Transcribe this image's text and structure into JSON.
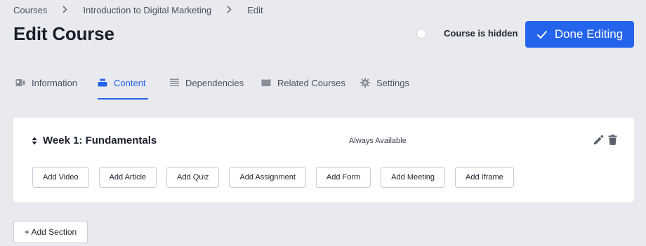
{
  "breadcrumb": {
    "items": [
      "Courses",
      "Introduction to Digital Marketing",
      "Edit"
    ],
    "separator": ">"
  },
  "header": {
    "title": "Edit Course",
    "visibility_label": "Course is hidden",
    "done_label": "Done Editing"
  },
  "tabs": [
    {
      "label": "Information",
      "icon": "id-card-icon"
    },
    {
      "label": "Content",
      "icon": "layers-icon",
      "active": true
    },
    {
      "label": "Dependencies",
      "icon": "list-icon"
    },
    {
      "label": "Related Courses",
      "icon": "book-icon"
    },
    {
      "label": "Settings",
      "icon": "gear-icon"
    }
  ],
  "section": {
    "title": "Week 1: Fundamentals",
    "availability": "Always Available",
    "add_buttons": [
      "Add Video",
      "Add Article",
      "Add Quiz",
      "Add Assignment",
      "Add Form",
      "Add Meeting",
      "Add Iframe"
    ]
  },
  "add_section_label": "+ Add Section",
  "colors": {
    "accent": "#2463eb",
    "background": "#e9eaee",
    "card": "#ffffff"
  }
}
